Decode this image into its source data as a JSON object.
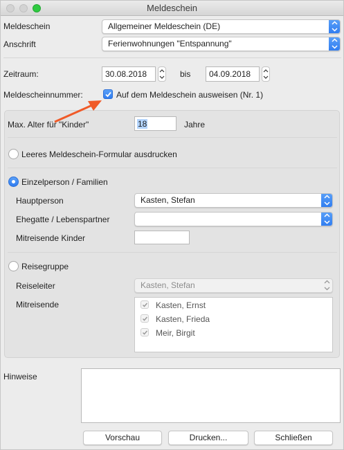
{
  "window": {
    "title": "Meldeschein"
  },
  "colors": {
    "accent": "#2f7cf0",
    "arrow_annotation": "#f05a28"
  },
  "form": {
    "meldeschein_label": "Meldeschein",
    "meldeschein_value": "Allgemeiner Meldeschein (DE)",
    "anschrift_label": "Anschrift",
    "anschrift_value": "Ferienwohnungen \"Entspannung\"",
    "zeitraum_label": "Zeitraum:",
    "date_from": "30.08.2018",
    "bis_label": "bis",
    "date_to": "04.09.2018",
    "nummer_label": "Meldescheinnummer:",
    "nummer_checkbox_label": "Auf dem Meldeschein ausweisen (Nr. 1)",
    "nummer_checkbox_checked": true
  },
  "group": {
    "max_alter_label": "Max. Alter für \"Kinder\"",
    "max_alter_value": "18",
    "max_alter_unit": "Jahre",
    "radio_leer_label": "Leeres Meldeschein-Formular ausdrucken",
    "radio_einzel_label": "Einzelperson / Familien",
    "selected_radio": "Einzelperson / Familien",
    "hauptperson_label": "Hauptperson",
    "hauptperson_value": "Kasten, Stefan",
    "ehegatte_label": "Ehegatte / Lebenspartner",
    "ehegatte_value": "",
    "kinder_label": "Mitreisende Kinder",
    "kinder_value": "",
    "radio_gruppe_label": "Reisegruppe",
    "reiseleiter_label": "Reiseleiter",
    "reiseleiter_value": "Kasten, Stefan",
    "mitreisende_label": "Mitreisende",
    "mitreisende": [
      {
        "name": "Kasten, Ernst",
        "checked": true
      },
      {
        "name": "Kasten, Frieda",
        "checked": true
      },
      {
        "name": "Meir, Birgit",
        "checked": true
      }
    ]
  },
  "hinweise_label": "Hinweise",
  "hinweise_value": "",
  "buttons": {
    "vorschau": "Vorschau",
    "drucken": "Drucken...",
    "schliessen": "Schließen"
  }
}
